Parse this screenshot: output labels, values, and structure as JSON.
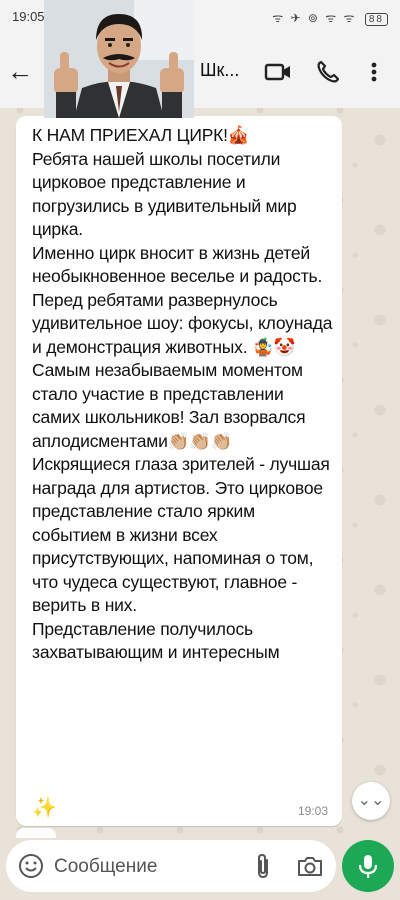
{
  "status_bar": {
    "time": "19:05",
    "icons": "ᯤ ✈ ⊚ ᯤ ᯤ",
    "battery": "88"
  },
  "header": {
    "back_icon": "arrow-left-icon",
    "title": "Шк...",
    "video_icon": "video-call-icon",
    "call_icon": "phone-icon",
    "menu_icon": "kebab-menu-icon"
  },
  "message": {
    "paragraphs": [
      "К НАМ ПРИЕХАЛ ЦИРК!🎪",
      "Ребята нашей школы посетили цирковое представление и погрузились в удивительный мир цирка.",
      "Именно цирк вносит в жизнь детей необыкновенное веселье и радость.",
      "Перед ребятами развернулось удивительное шоу: фокусы, клоунада и демонстрация животных. 🤹🤡",
      "Самым незабываемым моментом стало участие в представлении самих школьников! Зал взорвался аплодисментами👏🏼👏🏼👏🏼",
      "Искрящиеся глаза зрителей - лучшая награда для артистов. Это цирковое представление стало ярким событием в жизни всех присутствующих, напоминая о том, что чудеса существуют, главное - верить в них.",
      "Представление получилось захватывающим и интересным"
    ],
    "sparkle": "✨",
    "time": "19:03"
  },
  "composer": {
    "placeholder": "Сообщение",
    "emoji_icon": "emoji-icon",
    "attach_icon": "paperclip-icon",
    "camera_icon": "camera-icon",
    "mic_icon": "microphone-icon"
  },
  "colors": {
    "accent": "#1da856",
    "bubble": "#ffffff",
    "wallpaper": "#e9e2d8"
  }
}
